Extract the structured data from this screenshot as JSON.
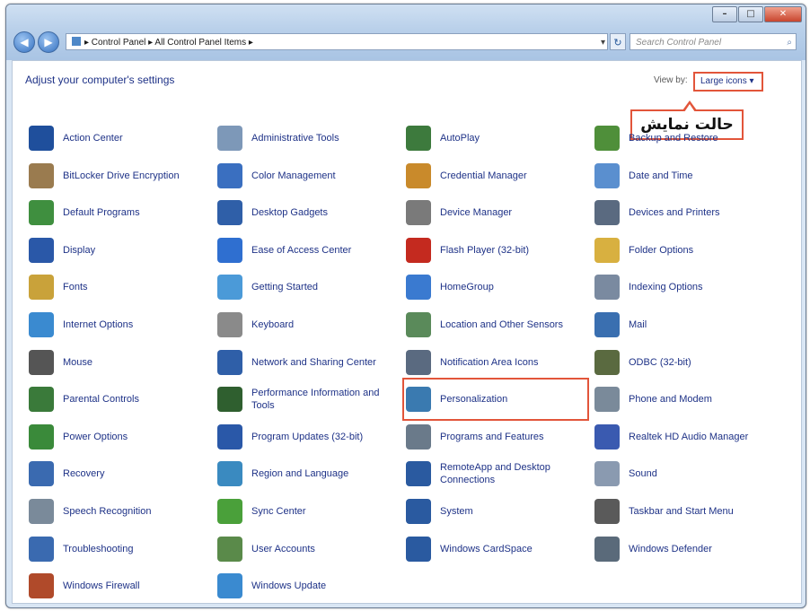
{
  "window": {
    "buttons": {
      "minimize": "–",
      "maximize": "□",
      "close": "✕"
    }
  },
  "address_bar": {
    "path": "▸ Control Panel ▸ All Control Panel Items ▸"
  },
  "search": {
    "placeholder": "Search Control Panel"
  },
  "heading": "Adjust your computer's settings",
  "view_by": {
    "label": "View by:",
    "value": "Large icons ▾"
  },
  "callout": {
    "text": "حالت نمایش"
  },
  "items": [
    {
      "label": "Action Center",
      "icon": "flag-icon",
      "color": "#1f4f9c"
    },
    {
      "label": "Administrative Tools",
      "icon": "admin-tools-icon",
      "color": "#7d98b8"
    },
    {
      "label": "AutoPlay",
      "icon": "autoplay-icon",
      "color": "#3d7a3d"
    },
    {
      "label": "Backup and Restore",
      "icon": "backup-icon",
      "color": "#4f8f3a"
    },
    {
      "label": "BitLocker Drive Encryption",
      "icon": "bitlocker-icon",
      "color": "#9a7b4f"
    },
    {
      "label": "Color Management",
      "icon": "color-management-icon",
      "color": "#3a6fc0"
    },
    {
      "label": "Credential Manager",
      "icon": "credential-icon",
      "color": "#c98a2b"
    },
    {
      "label": "Date and Time",
      "icon": "clock-icon",
      "color": "#5a8fcf"
    },
    {
      "label": "Default Programs",
      "icon": "default-programs-icon",
      "color": "#3f8f3f"
    },
    {
      "label": "Desktop Gadgets",
      "icon": "gadgets-icon",
      "color": "#2f5fa8"
    },
    {
      "label": "Device Manager",
      "icon": "device-manager-icon",
      "color": "#7a7a7a"
    },
    {
      "label": "Devices and Printers",
      "icon": "printer-icon",
      "color": "#5a6a80"
    },
    {
      "label": "Display",
      "icon": "display-icon",
      "color": "#2a58a8"
    },
    {
      "label": "Ease of Access Center",
      "icon": "ease-of-access-icon",
      "color": "#2f6fd0"
    },
    {
      "label": "Flash Player (32-bit)",
      "icon": "flash-icon",
      "color": "#c42a1f"
    },
    {
      "label": "Folder Options",
      "icon": "folder-icon",
      "color": "#d8b040"
    },
    {
      "label": "Fonts",
      "icon": "fonts-icon",
      "color": "#c9a23a"
    },
    {
      "label": "Getting Started",
      "icon": "getting-started-icon",
      "color": "#4b9ad8"
    },
    {
      "label": "HomeGroup",
      "icon": "homegroup-icon",
      "color": "#3a7ad0"
    },
    {
      "label": "Indexing Options",
      "icon": "indexing-icon",
      "color": "#7a8aa0"
    },
    {
      "label": "Internet Options",
      "icon": "internet-icon",
      "color": "#3a8ad0"
    },
    {
      "label": "Keyboard",
      "icon": "keyboard-icon",
      "color": "#8a8a8a"
    },
    {
      "label": "Location and Other Sensors",
      "icon": "location-icon",
      "color": "#5a8a5a"
    },
    {
      "label": "Mail",
      "icon": "mail-icon",
      "color": "#3a6fb0"
    },
    {
      "label": "Mouse",
      "icon": "mouse-icon",
      "color": "#555555"
    },
    {
      "label": "Network and Sharing Center",
      "icon": "network-icon",
      "color": "#2f5fa8"
    },
    {
      "label": "Notification Area Icons",
      "icon": "notification-icon",
      "color": "#5a6a80"
    },
    {
      "label": "ODBC (32-bit)",
      "icon": "odbc-icon",
      "color": "#5a6a40"
    },
    {
      "label": "Parental Controls",
      "icon": "parental-icon",
      "color": "#3a7a3a"
    },
    {
      "label": "Performance Information and Tools",
      "icon": "performance-icon",
      "color": "#2f5f2f"
    },
    {
      "label": "Personalization",
      "icon": "personalization-icon",
      "color": "#3a7ab0"
    },
    {
      "label": "Phone and Modem",
      "icon": "phone-icon",
      "color": "#7a8a9a"
    },
    {
      "label": "Power Options",
      "icon": "power-icon",
      "color": "#3a8a3a"
    },
    {
      "label": "Program Updates (32-bit)",
      "icon": "program-updates-icon",
      "color": "#2a58a8"
    },
    {
      "label": "Programs and Features",
      "icon": "programs-icon",
      "color": "#6a7a8a"
    },
    {
      "label": "Realtek HD Audio Manager",
      "icon": "audio-icon",
      "color": "#3a5ab0"
    },
    {
      "label": "Recovery",
      "icon": "recovery-icon",
      "color": "#3a6ab0"
    },
    {
      "label": "Region and Language",
      "icon": "region-icon",
      "color": "#3a8ac0"
    },
    {
      "label": "RemoteApp and Desktop Connections",
      "icon": "remoteapp-icon",
      "color": "#2a5aa0"
    },
    {
      "label": "Sound",
      "icon": "sound-icon",
      "color": "#8a9ab0"
    },
    {
      "label": "Speech Recognition",
      "icon": "microphone-icon",
      "color": "#7a8a9a"
    },
    {
      "label": "Sync Center",
      "icon": "sync-icon",
      "color": "#4aa03a"
    },
    {
      "label": "System",
      "icon": "system-icon",
      "color": "#2a5aa0"
    },
    {
      "label": "Taskbar and Start Menu",
      "icon": "taskbar-icon",
      "color": "#5a5a5a"
    },
    {
      "label": "Troubleshooting",
      "icon": "troubleshooting-icon",
      "color": "#3a6ab0"
    },
    {
      "label": "User Accounts",
      "icon": "user-accounts-icon",
      "color": "#5a8a4a"
    },
    {
      "label": "Windows CardSpace",
      "icon": "cardspace-icon",
      "color": "#2a5aa0"
    },
    {
      "label": "Windows Defender",
      "icon": "defender-icon",
      "color": "#5a6a7a"
    },
    {
      "label": "Windows Firewall",
      "icon": "firewall-icon",
      "color": "#b04a2a"
    },
    {
      "label": "Windows Update",
      "icon": "windows-update-icon",
      "color": "#3a8ad0"
    }
  ],
  "highlighted_item": "Personalization"
}
